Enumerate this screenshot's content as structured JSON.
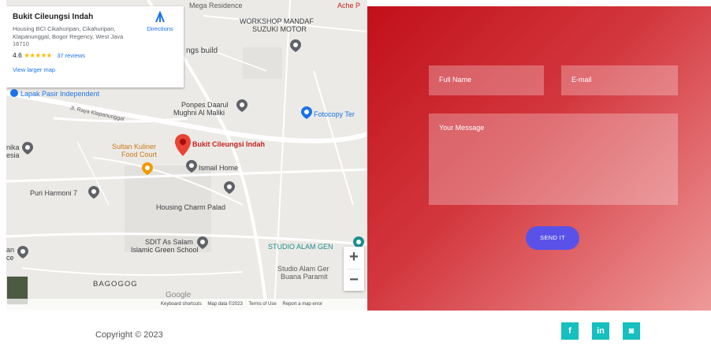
{
  "map": {
    "labels": {
      "mega_residence": "Mega Residence",
      "ache": "Ache P",
      "workshop_line1": "WORKSHOP MANDAF",
      "workshop_line2": "SUZUKI MOTOR",
      "ngs_build": "ngs build",
      "lapak": "Lapak Pasir Independent",
      "ponpes_line1": "Ponpes Daarul",
      "ponpes_line2": "Mughni Al Maliki",
      "fotocopy": "Fotocopy Ter",
      "jl_raya": "Jl. Raya Klapanunggal",
      "nika_line1": "nika",
      "nika_line2": "esia",
      "sultan_line1": "Sultan Kuliner",
      "sultan_line2": "Food Court",
      "bukit_marker": "Bukit Cileungsi Indah",
      "ismail": "Ismail Home",
      "puri": "Puri Harmoni 7",
      "housing": "Housing Charm Palad",
      "sdit_line1": "SDIT As Salam",
      "sdit_line2": "Islamic Green School",
      "studio": "STUDIO ALAM GEN",
      "studio2_line1": "Studio Alam Ger",
      "studio2_line2": "Buana Paramit",
      "bagogog": "BAGOGOG",
      "an_line1": "an",
      "an_line2": "ce"
    },
    "card": {
      "title": "Bukit Cileungsi Indah",
      "address": "Housing BCI Cikahuripan, Cikahuripan, Klapanunggal, Bogor Regency, West Java 16710",
      "rating": "4.6",
      "stars": "★★★★★",
      "reviews": "37 reviews",
      "larger_map": "View larger map",
      "directions": "Directions"
    },
    "zoom_in": "+",
    "zoom_out": "−",
    "google": "Google",
    "attribution": {
      "shortcuts": "Keyboard shortcuts",
      "map_data": "Map data ©2023",
      "terms": "Terms of Use",
      "report": "Report a map error"
    }
  },
  "form": {
    "full_name_placeholder": "Full Name",
    "email_placeholder": "E-mail",
    "message_placeholder": "Your Message",
    "send_label": "SEND IT"
  },
  "footer": {
    "copyright": "Copyright © 2023",
    "social": [
      "f",
      "in",
      "◙"
    ]
  },
  "colors": {
    "accent_red": "#c1101a",
    "button": "#5a52e8",
    "social": "#17bfbf"
  }
}
